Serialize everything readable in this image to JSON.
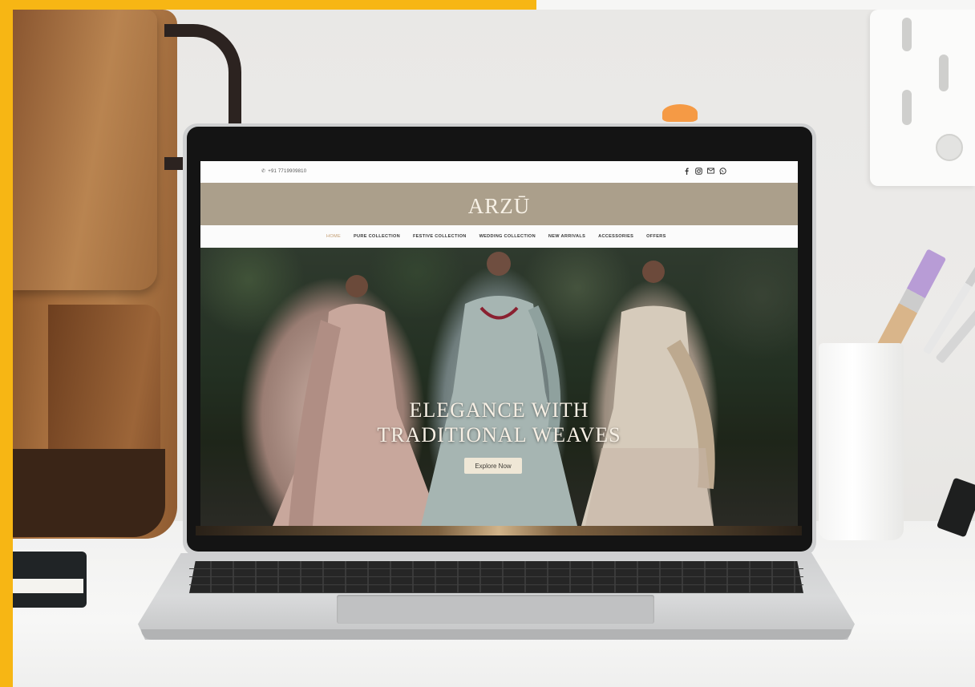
{
  "site": {
    "phone": "+91 7719909810",
    "logo": "ARZŪ",
    "nav": [
      {
        "label": "HOME",
        "active": true
      },
      {
        "label": "PURE COLLECTION",
        "active": false
      },
      {
        "label": "FESTIVE COLLECTION",
        "active": false
      },
      {
        "label": "WEDDING COLLECTION",
        "active": false
      },
      {
        "label": "NEW ARRIVALS",
        "active": false
      },
      {
        "label": "ACCESSORIES",
        "active": false
      },
      {
        "label": "OFFERS",
        "active": false
      }
    ],
    "socials": [
      "facebook-icon",
      "instagram-icon",
      "mail-icon",
      "whatsapp-icon"
    ],
    "hero": {
      "title_line1": "ELEGANCE WITH",
      "title_line2": "TRADITIONAL WEAVES",
      "cta": "Explore Now"
    }
  },
  "colors": {
    "brand": "#ab9f8b",
    "accent": "#c09a6e",
    "frame": "#f7b614"
  }
}
